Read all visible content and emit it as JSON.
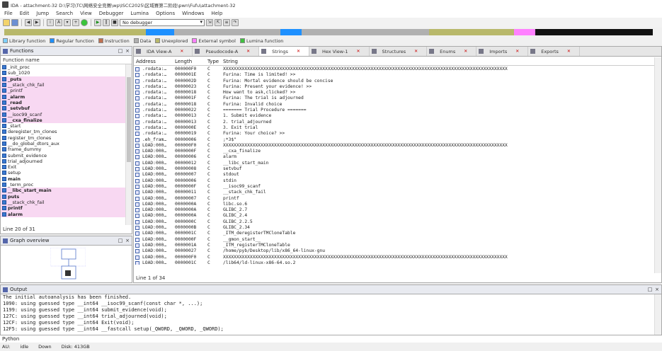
{
  "window": {
    "title": "IDA - attachment-32 D:\\学习\\TC\\网络安全竞赛\\wp\\ISCC2025\\区域赛第二阶段\\pwn\\Fufu\\attachment-32"
  },
  "menu": [
    "File",
    "Edit",
    "Jump",
    "Search",
    "View",
    "Debugger",
    "Lumina",
    "Options",
    "Windows",
    "Help"
  ],
  "toolbar": {
    "debugger_select": "No debugger"
  },
  "legend": [
    {
      "label": "Library function",
      "color": "#7fd0ff"
    },
    {
      "label": "Regular function",
      "color": "#1e90ff"
    },
    {
      "label": "Instruction",
      "color": "#c07050"
    },
    {
      "label": "Data",
      "color": "#b0b0b0"
    },
    {
      "label": "Unexplored",
      "color": "#b8b86a"
    },
    {
      "label": "External symbol",
      "color": "#ff80ff"
    },
    {
      "label": "Lumina function",
      "color": "#40c040"
    }
  ],
  "functions": {
    "panel_title": "Functions",
    "column_header": "Function name",
    "items": [
      {
        "name": "_init_proc",
        "pink": false,
        "bold": false
      },
      {
        "name": "sub_1020",
        "pink": false,
        "bold": false
      },
      {
        "name": "_puts",
        "pink": true,
        "bold": true
      },
      {
        "name": "__stack_chk_fail",
        "pink": true,
        "bold": false
      },
      {
        "name": "_printf",
        "pink": true,
        "bold": false
      },
      {
        "name": "_alarm",
        "pink": true,
        "bold": true
      },
      {
        "name": "_read",
        "pink": true,
        "bold": true
      },
      {
        "name": "_setvbuf",
        "pink": true,
        "bold": true
      },
      {
        "name": "__isoc99_scanf",
        "pink": true,
        "bold": false
      },
      {
        "name": "__cxa_finalize",
        "pink": true,
        "bold": true
      },
      {
        "name": "_start",
        "pink": false,
        "bold": false
      },
      {
        "name": "deregister_tm_clones",
        "pink": false,
        "bold": false
      },
      {
        "name": "register_tm_clones",
        "pink": false,
        "bold": false
      },
      {
        "name": "__do_global_dtors_aux",
        "pink": false,
        "bold": false
      },
      {
        "name": "frame_dummy",
        "pink": false,
        "bold": false
      },
      {
        "name": "submit_evidence",
        "pink": false,
        "bold": false
      },
      {
        "name": "trial_adjourned",
        "pink": false,
        "bold": false
      },
      {
        "name": "Exit",
        "pink": false,
        "bold": false
      },
      {
        "name": "setup",
        "pink": false,
        "bold": false
      },
      {
        "name": "main",
        "pink": false,
        "bold": true
      },
      {
        "name": "_term_proc",
        "pink": false,
        "bold": false
      },
      {
        "name": "__libc_start_main",
        "pink": true,
        "bold": true
      },
      {
        "name": "puts",
        "pink": true,
        "bold": true
      },
      {
        "name": "__stack_chk_fail",
        "pink": true,
        "bold": false
      },
      {
        "name": "printf",
        "pink": true,
        "bold": true
      },
      {
        "name": "alarm",
        "pink": true,
        "bold": true
      }
    ],
    "status": "Line 20 of 31"
  },
  "graph": {
    "panel_title": "Graph overview"
  },
  "tabs": [
    {
      "label": "IDA View-A",
      "active": false,
      "close": true
    },
    {
      "label": "Pseudocode-A",
      "active": false,
      "close": true
    },
    {
      "label": "Strings",
      "active": true,
      "close": true
    },
    {
      "label": "Hex View-1",
      "active": false,
      "close": true
    },
    {
      "label": "Structures",
      "active": false,
      "close": true
    },
    {
      "label": "Enums",
      "active": false,
      "close": true
    },
    {
      "label": "Imports",
      "active": false,
      "close": true
    },
    {
      "label": "Exports",
      "active": false,
      "close": true
    }
  ],
  "strings": {
    "columns": {
      "address": "Address",
      "length": "Length",
      "type": "Type",
      "string": "String"
    },
    "rows": [
      {
        "address": ".rodata:…",
        "length": "000000F0",
        "type": "C",
        "string": "XXXXXXXXXXXXXXXXXXXXXXXXXXXXXXXXXXXXXXXXXXXXXXXXXXXXXXXXXXXXXXXXXXXXXXXXXXXXXXXXXXXXXXXXXXXXXXXXXXXXXXXXXX"
      },
      {
        "address": ".rodata:…",
        "length": "0000001E",
        "type": "C",
        "string": "Furina: Time is limited! >>"
      },
      {
        "address": ".rodata:…",
        "length": "0000002D",
        "type": "C",
        "string": "Furina: Mortal evidence should be concise"
      },
      {
        "address": ".rodata:…",
        "length": "00000023",
        "type": "C",
        "string": "Furina: Present your evidence! >>"
      },
      {
        "address": ".rodata:…",
        "length": "00000018",
        "type": "C",
        "string": "How want to ask,clicked? >>"
      },
      {
        "address": ".rodata:…",
        "length": "0000001F",
        "type": "C",
        "string": "Furina: The trial is adjourned"
      },
      {
        "address": ".rodata:…",
        "length": "00000018",
        "type": "C",
        "string": "Furina: Invalid choice"
      },
      {
        "address": ".rodata:…",
        "length": "00000022",
        "type": "C",
        "string": "======= Trial Procedure ======="
      },
      {
        "address": ".rodata:…",
        "length": "00000013",
        "type": "C",
        "string": "1. Submit evidence"
      },
      {
        "address": ".rodata:…",
        "length": "00000013",
        "type": "C",
        "string": "2. trial_adjourned"
      },
      {
        "address": ".rodata:…",
        "length": "0000000E",
        "type": "C",
        "string": "3. Exit trial"
      },
      {
        "address": ".rodata:…",
        "length": "00000019",
        "type": "C",
        "string": "Furina: Your choice? >>"
      },
      {
        "address": ".eh_fram…",
        "length": "00000006",
        "type": "C",
        "string": ";*3$\""
      },
      {
        "address": "LOAD:000…",
        "length": "000000F0",
        "type": "C",
        "string": "XXXXXXXXXXXXXXXXXXXXXXXXXXXXXXXXXXXXXXXXXXXXXXXXXXXXXXXXXXXXXXXXXXXXXXXXXXXXXXXXXXXXXXXXXXXXXXXXXXXXXXXXXX"
      },
      {
        "address": "LOAD:000…",
        "length": "0000000F",
        "type": "C",
        "string": "__cxa_finalize"
      },
      {
        "address": "LOAD:000…",
        "length": "00000006",
        "type": "C",
        "string": "alarm"
      },
      {
        "address": "LOAD:000…",
        "length": "00000012",
        "type": "C",
        "string": "__libc_start_main"
      },
      {
        "address": "LOAD:000…",
        "length": "00000008",
        "type": "C",
        "string": "setvbuf"
      },
      {
        "address": "LOAD:000…",
        "length": "00000007",
        "type": "C",
        "string": "stdout"
      },
      {
        "address": "LOAD:000…",
        "length": "00000006",
        "type": "C",
        "string": "stdin"
      },
      {
        "address": "LOAD:000…",
        "length": "0000000F",
        "type": "C",
        "string": "__isoc99_scanf"
      },
      {
        "address": "LOAD:000…",
        "length": "00000011",
        "type": "C",
        "string": "__stack_chk_fail"
      },
      {
        "address": "LOAD:000…",
        "length": "00000007",
        "type": "C",
        "string": "printf"
      },
      {
        "address": "LOAD:000…",
        "length": "0000000A",
        "type": "C",
        "string": "libc.so.6"
      },
      {
        "address": "LOAD:000…",
        "length": "0000000A",
        "type": "C",
        "string": "GLIBC_2.7"
      },
      {
        "address": "LOAD:000…",
        "length": "0000000A",
        "type": "C",
        "string": "GLIBC_2.4"
      },
      {
        "address": "LOAD:000…",
        "length": "0000000C",
        "type": "C",
        "string": "GLIBC_2.2.5"
      },
      {
        "address": "LOAD:000…",
        "length": "0000000B",
        "type": "C",
        "string": "GLIBC_2.34"
      },
      {
        "address": "LOAD:000…",
        "length": "0000001C",
        "type": "C",
        "string": "_ITM_deregisterTMCloneTable"
      },
      {
        "address": "LOAD:000…",
        "length": "0000000F",
        "type": "C",
        "string": "__gmon_start__"
      },
      {
        "address": "LOAD:000…",
        "length": "0000001A",
        "type": "C",
        "string": "_ITM_registerTMCloneTable"
      },
      {
        "address": "LOAD:000…",
        "length": "00000027",
        "type": "C",
        "string": "/home/pyb/Desktop/lib/x86_64-linux-gnu"
      },
      {
        "address": "LOAD:000…",
        "length": "000000F0",
        "type": "C",
        "string": "XXXXXXXXXXXXXXXXXXXXXXXXXXXXXXXXXXXXXXXXXXXXXXXXXXXXXXXXXXXXXXXXXXXXXXXXXXXXXXXXXXXXXXXXXXXXXXXXXXXXXXXXXX"
      },
      {
        "address": "LOAD:000…",
        "length": "0000001C",
        "type": "C",
        "string": "/lib64/ld-linux-x86-64.so.2"
      }
    ],
    "status": "Line 1 of 34"
  },
  "output": {
    "panel_title": "Output",
    "lines": [
      "The initial autoanalysis has been finished.",
      "1090: using guessed type __int64 __isoc99_scanf(const char *, ...);",
      "1199: using guessed type __int64 submit_evidence(void);",
      "127C: using guessed type __int64 trial_adjourned(void);",
      "12CF: using guessed type __int64 Exit(void);",
      "12F5: using guessed type __int64 __fastcall setup(_QWORD, _QWORD, _QWORD);"
    ]
  },
  "python": {
    "label": "Python",
    "value": ""
  },
  "status": {
    "au": "AU:",
    "state": "idle",
    "direction": "Down",
    "disk": "Disk: 413GB"
  }
}
